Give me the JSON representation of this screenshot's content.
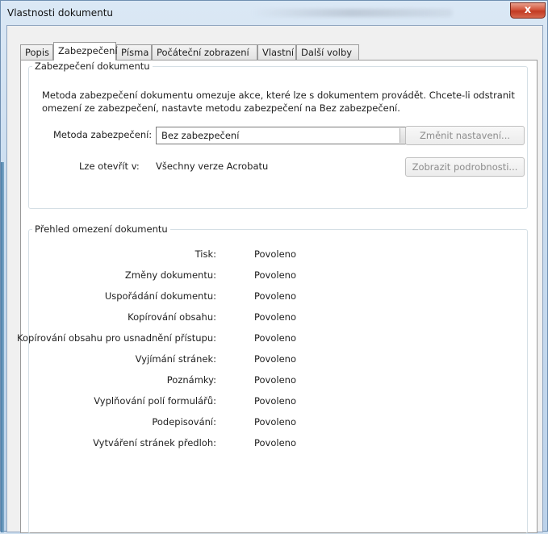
{
  "window": {
    "title": "Vlastnosti dokumentu",
    "close_label": "x"
  },
  "tabs": [
    {
      "label": "Popis"
    },
    {
      "label": "Zabezpečení"
    },
    {
      "label": "Písma"
    },
    {
      "label": "Počáteční zobrazení"
    },
    {
      "label": "Vlastní"
    },
    {
      "label": "Další volby"
    }
  ],
  "active_tab": "Zabezpečení",
  "security": {
    "group_title": "Zabezpečení dokumentu",
    "description": "Metoda zabezpečení dokumentu omezuje akce, které lze s dokumentem provádět. Chcete-li odstranit omezení ze zabezpečení, nastavte metodu zabezpečení na Bez zabezpečení.",
    "method_label": "Metoda zabezpečení:",
    "method_value": "Bez zabezpečení",
    "change_button": "Změnit nastavení...",
    "open_label": "Lze otevřít v:",
    "open_value": "Všechny verze Acrobatu",
    "details_button": "Zobrazit podrobnosti..."
  },
  "restrictions": {
    "group_title": "Přehled omezení dokumentu",
    "rows": [
      {
        "label": "Tisk:",
        "value": "Povoleno"
      },
      {
        "label": "Změny dokumentu:",
        "value": "Povoleno"
      },
      {
        "label": "Uspořádání dokumentu:",
        "value": "Povoleno"
      },
      {
        "label": "Kopírování obsahu:",
        "value": "Povoleno"
      },
      {
        "label": "Kopírování obsahu pro usnadnění přístupu:",
        "value": "Povoleno"
      },
      {
        "label": "Vyjímání stránek:",
        "value": "Povoleno"
      },
      {
        "label": "Poznámky:",
        "value": "Povoleno"
      },
      {
        "label": "Vyplňování polí formulářů:",
        "value": "Povoleno"
      },
      {
        "label": "Podepisování:",
        "value": "Povoleno"
      },
      {
        "label": "Vytváření stránek předloh:",
        "value": "Povoleno"
      }
    ]
  }
}
